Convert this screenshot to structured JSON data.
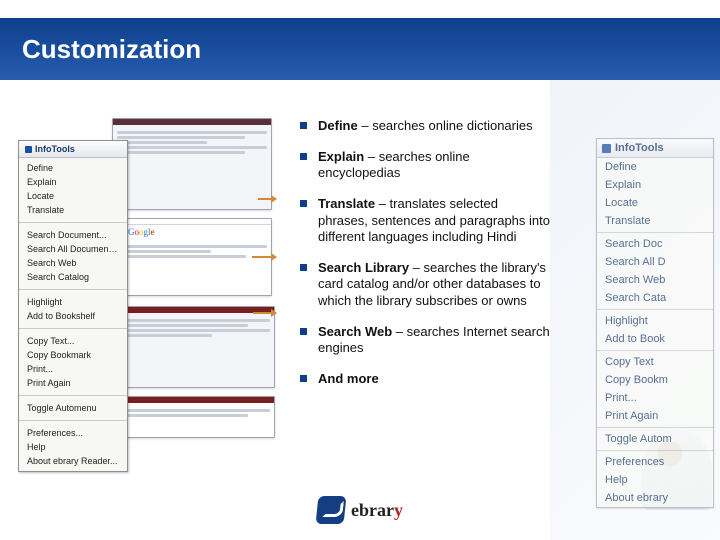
{
  "title": "Customization",
  "bullets": [
    {
      "term": "Define",
      "desc": " – searches online dictionaries"
    },
    {
      "term": "Explain",
      "desc": " – searches online encyclopedias"
    },
    {
      "term": "Translate",
      "desc": " – translates selected phrases, sentences and paragraphs into different languages including Hindi"
    },
    {
      "term": "Search Library",
      "desc": " – searches the library's card catalog and/or other databases to which the library subscribes or owns"
    },
    {
      "term": "Search Web",
      "desc": " – searches Internet search engines"
    },
    {
      "term": "And more",
      "desc": ""
    }
  ],
  "infotools_header": "InfoTools",
  "infotools_small": {
    "group1": [
      "Define",
      "Explain",
      "Locate",
      "Translate"
    ],
    "group2": [
      "Search Document...",
      "Search All Documents...",
      "Search Web",
      "Search Catalog"
    ],
    "group3": [
      "Highlight",
      "Add to Bookshelf"
    ],
    "group4": [
      "Copy Text...",
      "Copy Bookmark",
      "Print...",
      "Print Again"
    ],
    "group5": [
      "Toggle Automenu"
    ],
    "group6": [
      "Preferences...",
      "Help",
      "About ebrary Reader..."
    ]
  },
  "infotools_big": {
    "group1": [
      "Define",
      "Explain",
      "Locate",
      "Translate"
    ],
    "group2": [
      "Search Doc",
      "Search All D",
      "Search Web",
      "Search Cata"
    ],
    "group3": [
      "Highlight",
      "Add to Book"
    ],
    "group4": [
      "Copy Text",
      "Copy Bookm",
      "Print...",
      "Print Again"
    ],
    "group5": [
      "Toggle Autom"
    ],
    "group6": [
      "Preferences",
      "Help",
      "About ebrary"
    ]
  },
  "brand": {
    "name_pre": "ebrar",
    "name_accent": "y"
  }
}
